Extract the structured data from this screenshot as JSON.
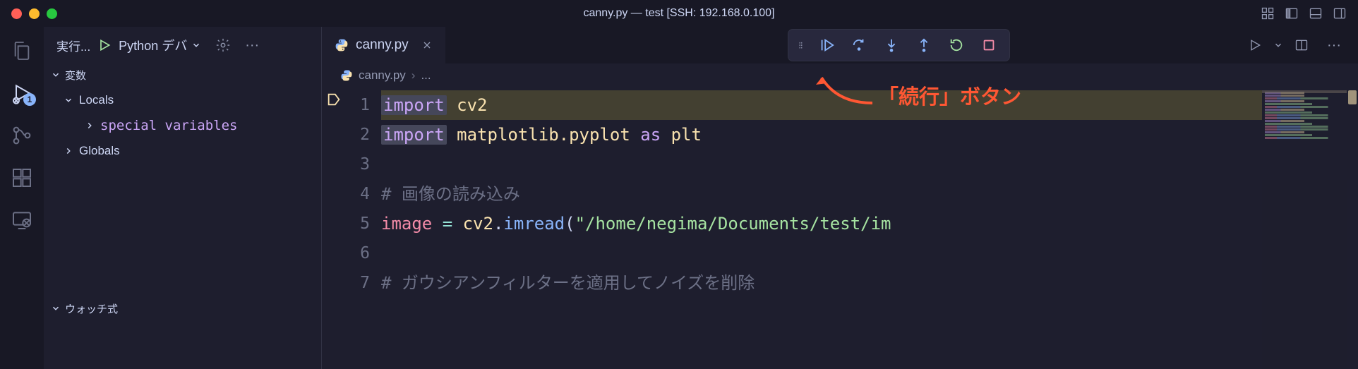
{
  "title": "canny.py — test [SSH: 192.168.0.100]",
  "sidebar": {
    "runLabel": "実行...",
    "config": "Python デバ",
    "sections": {
      "variables": "変数",
      "locals": "Locals",
      "special": "special variables",
      "globals": "Globals",
      "watch": "ウォッチ式"
    }
  },
  "tab": {
    "filename": "canny.py"
  },
  "breadcrumb": {
    "filename": "canny.py",
    "more": "..."
  },
  "activityBadge": "1",
  "annotation": "「続行」ボタン",
  "code": {
    "lines": [
      {
        "n": 1,
        "hl": true,
        "tokens": [
          [
            "kw-box",
            "import"
          ],
          [
            "sp",
            " "
          ],
          [
            "id",
            "cv2"
          ]
        ]
      },
      {
        "n": 2,
        "tokens": [
          [
            "kw-box",
            "import"
          ],
          [
            "sp",
            " "
          ],
          [
            "id",
            "matplotlib.pyplot"
          ],
          [
            "sp",
            " "
          ],
          [
            "kw",
            "as"
          ],
          [
            "sp",
            " "
          ],
          [
            "id",
            "plt"
          ]
        ]
      },
      {
        "n": 3,
        "tokens": []
      },
      {
        "n": 4,
        "tokens": [
          [
            "cm",
            "# 画像の読み込み"
          ]
        ]
      },
      {
        "n": 5,
        "tokens": [
          [
            "var",
            "image"
          ],
          [
            "sp",
            " "
          ],
          [
            "op",
            "="
          ],
          [
            "sp",
            " "
          ],
          [
            "id",
            "cv2"
          ],
          [
            "txt",
            "."
          ],
          [
            "fn",
            "imread"
          ],
          [
            "txt",
            "("
          ],
          [
            "str",
            "\"/home/negima/Documents/test/im"
          ]
        ]
      },
      {
        "n": 6,
        "tokens": []
      },
      {
        "n": 7,
        "tokens": [
          [
            "cm",
            "# ガウシアンフィルターを適用してノイズを削除"
          ]
        ]
      }
    ]
  }
}
